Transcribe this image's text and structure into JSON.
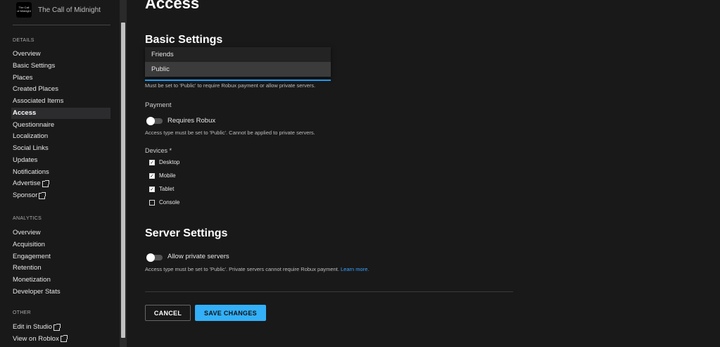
{
  "game": {
    "title": "The Call of Midnight",
    "thumb_text": "The Call of Midnight"
  },
  "sidebar": {
    "details_label": "DETAILS",
    "details": [
      {
        "label": "Overview"
      },
      {
        "label": "Basic Settings"
      },
      {
        "label": "Places"
      },
      {
        "label": "Created Places"
      },
      {
        "label": "Associated Items"
      },
      {
        "label": "Access"
      },
      {
        "label": "Questionnaire"
      },
      {
        "label": "Localization"
      },
      {
        "label": "Social Links"
      },
      {
        "label": "Updates"
      },
      {
        "label": "Notifications"
      },
      {
        "label": "Advertise"
      },
      {
        "label": "Sponsor"
      }
    ],
    "analytics_label": "ANALYTICS",
    "analytics": [
      {
        "label": "Overview"
      },
      {
        "label": "Acquisition"
      },
      {
        "label": "Engagement"
      },
      {
        "label": "Retention"
      },
      {
        "label": "Monetization"
      },
      {
        "label": "Developer Stats"
      }
    ],
    "other_label": "OTHER",
    "other": [
      {
        "label": "Edit in Studio"
      },
      {
        "label": "View on Roblox"
      }
    ]
  },
  "main": {
    "title": "Access",
    "basic_title": "Basic Settings",
    "dropdown_options": [
      "Friends",
      "Public"
    ],
    "dropdown_selected": "Public",
    "access_help": "Must be set to 'Public' to require Robux payment or allow private servers.",
    "payment_label": "Payment",
    "requires_robux": "Requires Robux",
    "payment_help": "Access type must be set to 'Public'. Cannot be applied to private servers.",
    "devices_label": "Devices *",
    "devices": [
      {
        "label": "Desktop",
        "checked": true
      },
      {
        "label": "Mobile",
        "checked": true
      },
      {
        "label": "Tablet",
        "checked": true
      },
      {
        "label": "Console",
        "checked": false
      }
    ],
    "server_title": "Server Settings",
    "allow_private": "Allow private servers",
    "server_help": "Access type must be set to 'Public'. Private servers cannot require Robux payment.",
    "learn_more": "Learn more.",
    "cancel": "CANCEL",
    "save": "SAVE CHANGES"
  }
}
